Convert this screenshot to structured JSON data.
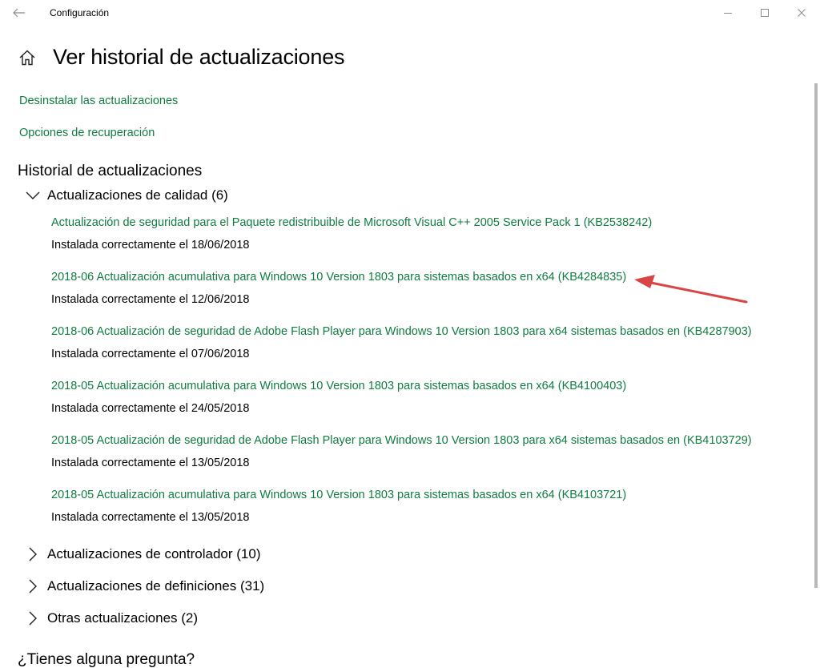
{
  "window": {
    "title": "Configuración"
  },
  "page": {
    "title": "Ver historial de actualizaciones"
  },
  "links": {
    "uninstall": "Desinstalar las actualizaciones",
    "recovery": "Opciones de recuperación"
  },
  "history": {
    "title": "Historial de actualizaciones",
    "groups": {
      "quality": "Actualizaciones de calidad (6)",
      "drivers": "Actualizaciones de controlador (10)",
      "definitions": "Actualizaciones de definiciones (31)",
      "other": "Otras actualizaciones (2)"
    },
    "updates": [
      {
        "title": "Actualización de seguridad para el Paquete redistribuible de Microsoft Visual C++ 2005 Service Pack 1 (KB2538242)",
        "status": "Instalada correctamente el 18/06/2018"
      },
      {
        "title": "2018-06 Actualización acumulativa para Windows 10 Version 1803 para sistemas basados en x64 (KB4284835)",
        "status": "Instalada correctamente el 12/06/2018"
      },
      {
        "title": "2018-06 Actualización de seguridad de Adobe Flash Player para Windows 10 Version 1803 para x64 sistemas basados en (KB4287903)",
        "status": "Instalada correctamente el 07/06/2018"
      },
      {
        "title": "2018-05 Actualización acumulativa para Windows 10 Version 1803 para sistemas basados en x64 (KB4100403)",
        "status": "Instalada correctamente el 24/05/2018"
      },
      {
        "title": "2018-05 Actualización de seguridad de Adobe Flash Player para Windows 10 Version 1803 para x64 sistemas basados en (KB4103729)",
        "status": "Instalada correctamente el 13/05/2018"
      },
      {
        "title": "2018-05 Actualización acumulativa para Windows 10 Version 1803 para sistemas basados en x64 (KB4103721)",
        "status": "Instalada correctamente el 13/05/2018"
      }
    ]
  },
  "footer": {
    "question": "¿Tienes alguna pregunta?"
  },
  "colors": {
    "link": "#107c41",
    "annotation_arrow": "#d94545"
  },
  "icons": {
    "back": "back-arrow-icon",
    "home": "home-icon",
    "minimize": "minimize-icon",
    "maximize": "maximize-icon",
    "close": "close-icon",
    "expanded": "chevron-down-icon",
    "collapsed": "chevron-right-icon"
  }
}
